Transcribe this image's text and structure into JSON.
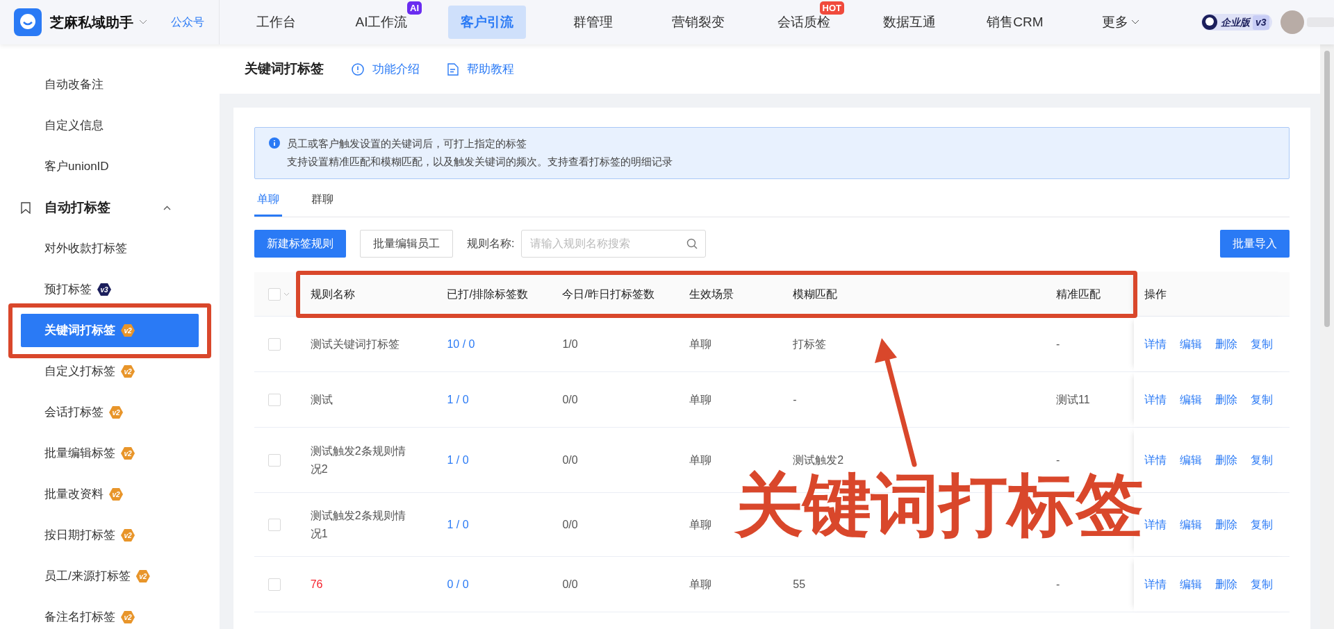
{
  "app": {
    "name": "芝麻私域助手",
    "account_link": "公众号"
  },
  "nav": [
    {
      "label": "工作台",
      "selected": false
    },
    {
      "label": "AI工作流",
      "selected": false,
      "badge": {
        "text": "AI",
        "color": "#6a2cf0"
      }
    },
    {
      "label": "客户引流",
      "selected": true
    },
    {
      "label": "群管理",
      "selected": false
    },
    {
      "label": "营销裂变",
      "selected": false
    },
    {
      "label": "会话质检",
      "selected": false,
      "badge": {
        "text": "HOT",
        "color": "#f04a3c"
      }
    },
    {
      "label": "数据互通",
      "selected": false
    },
    {
      "label": "销售CRM",
      "selected": false
    }
  ],
  "more": "更多",
  "edition": {
    "label": "企业版",
    "version": "v3"
  },
  "sidebar": {
    "items": [
      {
        "label": "自动改备注",
        "selected": false
      },
      {
        "label": "自定义信息",
        "selected": false
      },
      {
        "label": "客户unionID",
        "selected": false
      }
    ],
    "group": {
      "label": "自动打标签",
      "expanded": true,
      "children": [
        {
          "label": "对外收款打标签",
          "selected": false
        },
        {
          "label": "预打标签",
          "selected": false,
          "badge": "v3"
        },
        {
          "label": "关键词打标签",
          "selected": true,
          "badge": "v2"
        },
        {
          "label": "自定义打标签",
          "selected": false,
          "badge": "v2"
        },
        {
          "label": "会话打标签",
          "selected": false,
          "badge": "v2"
        },
        {
          "label": "批量编辑标签",
          "selected": false,
          "badge": "v2"
        },
        {
          "label": "批量改资料",
          "selected": false,
          "badge": "v2"
        },
        {
          "label": "按日期打标签",
          "selected": false,
          "badge": "v2"
        },
        {
          "label": "员工/来源打标签",
          "selected": false,
          "badge": "v2"
        },
        {
          "label": "备注名打标签",
          "selected": false,
          "badge": "v2"
        }
      ]
    }
  },
  "page": {
    "title": "关键词打标签",
    "links": [
      {
        "label": "功能介绍",
        "kind": "info"
      },
      {
        "label": "帮助教程",
        "kind": "doc"
      }
    ]
  },
  "notice": [
    "员工或客户触发设置的关键词后，可打上指定的标签",
    "支持设置精准匹配和模糊匹配，以及触发关键词的频次。支持查看打标签的明细记录"
  ],
  "tabs": [
    {
      "label": "单聊",
      "selected": true
    },
    {
      "label": "群聊",
      "selected": false
    }
  ],
  "toolbar": {
    "create_button": "新建标签规则",
    "batch_edit_button": "批量编辑员工",
    "search_label": "规则名称:",
    "search_placeholder": "请输入规则名称搜索",
    "import_button": "批量导入"
  },
  "table": {
    "all_checked": false,
    "columns": [
      "规则名称",
      "已打/排除标签数",
      "今日/昨日打标签数",
      "生效场景",
      "模糊匹配",
      "精准匹配",
      "操作"
    ],
    "rows": [
      {
        "checked": false,
        "name": "测试关键词打标签",
        "flagged": false,
        "tagged_excluded": "10 / 0",
        "today_yesterday": "1/0",
        "scene": "单聊",
        "fuzzy": "打标签",
        "exact": "-",
        "actions": [
          "详情",
          "编辑",
          "删除",
          "复制"
        ]
      },
      {
        "checked": false,
        "name": "测试",
        "flagged": false,
        "tagged_excluded": "1 / 0",
        "today_yesterday": "0/0",
        "scene": "单聊",
        "fuzzy": "-",
        "exact": "测试11",
        "actions": [
          "详情",
          "编辑",
          "删除",
          "复制"
        ]
      },
      {
        "checked": false,
        "name": "测试触发2条规则情况2",
        "flagged": false,
        "tagged_excluded": "1 / 0",
        "today_yesterday": "0/0",
        "scene": "单聊",
        "fuzzy": "测试触发2",
        "exact": "-",
        "actions": [
          "详情",
          "编辑",
          "删除",
          "复制"
        ]
      },
      {
        "checked": false,
        "name": "测试触发2条规则情况1",
        "flagged": false,
        "tagged_excluded": "1 / 0",
        "today_yesterday": "0/0",
        "scene": "单聊",
        "actions": [
          "详情",
          "编辑",
          "删除",
          "复制"
        ]
      },
      {
        "checked": false,
        "name": "76",
        "flagged": true,
        "tagged_excluded": "0 / 0",
        "today_yesterday": "0/0",
        "scene": "单聊",
        "fuzzy": "55",
        "exact": "-",
        "actions": [
          "详情",
          "编辑",
          "删除",
          "复制"
        ]
      }
    ]
  },
  "annotation": {
    "text": "关键词打标签"
  }
}
